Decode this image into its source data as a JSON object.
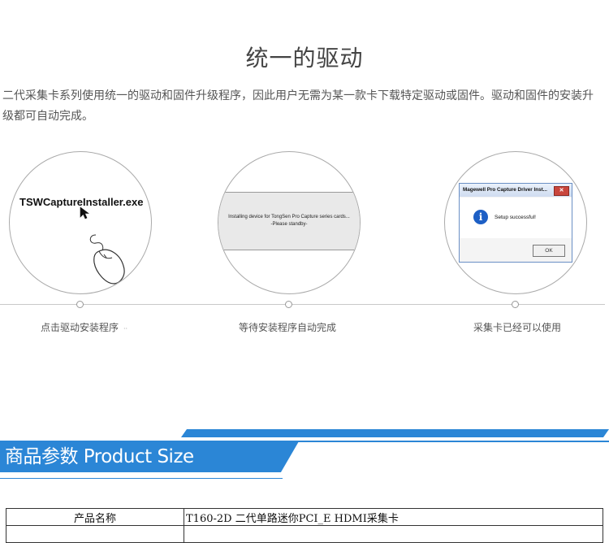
{
  "section": {
    "title": "统一的驱动",
    "description": "二代采集卡系列使用统一的驱动和固件升级程序，因此用户无需为某一款卡下载特定驱动或固件。驱动和固件的安装升级都可自动完成。"
  },
  "steps": [
    {
      "caption": "点击驱动安装程序",
      "caption_suffix": "··",
      "illustration_text": "TSWCaptureInstaller.exe"
    },
    {
      "caption": "等待安装程序自动完成",
      "install_line1": "Installing device for  TongSen  Pro Capture series cards...",
      "install_line2": "-Please standby-"
    },
    {
      "caption": "采集卡已经可以使用",
      "dialog_title": "Magewell Pro Capture Driver Inst...",
      "dialog_close": "✕",
      "dialog_icon": "i",
      "dialog_message": "Setup successful!",
      "dialog_ok": "OK"
    }
  ],
  "product_section": {
    "banner": "商品参数 Product Size",
    "accent_color": "#2b86d6"
  },
  "spec_table": {
    "rows": [
      {
        "key": "产品名称",
        "value": "T160-2D  二代单路迷你PCI_E  HDMI采集卡"
      }
    ]
  }
}
